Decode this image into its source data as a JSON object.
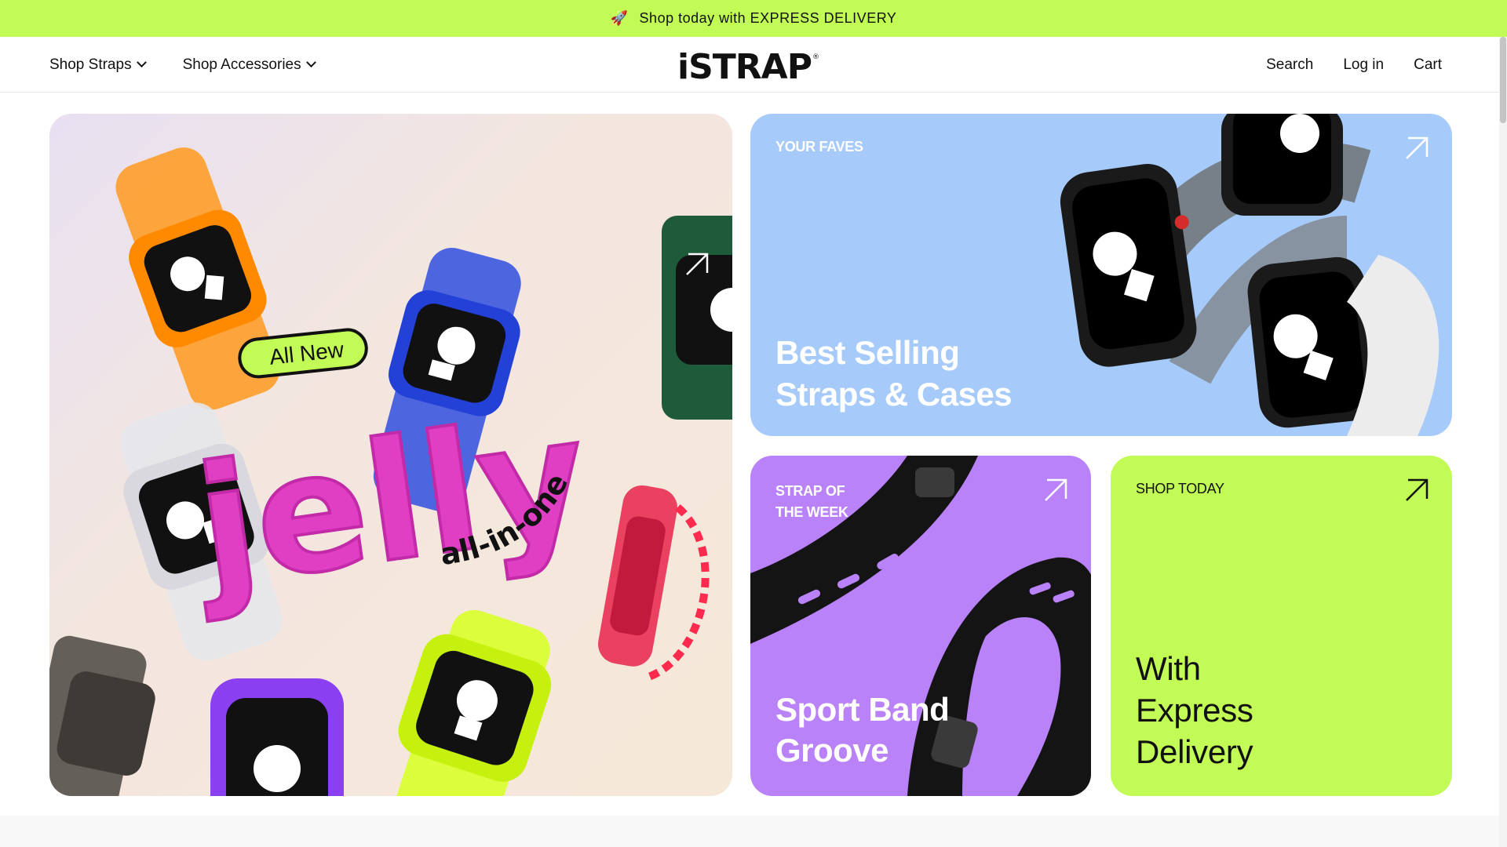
{
  "announcement": {
    "icon": "rocket-icon",
    "text": "Shop today with EXPRESS DELIVERY"
  },
  "header": {
    "logo": "iSTRAP",
    "logo_mark": "®",
    "nav_left": [
      {
        "label": "Shop Straps"
      },
      {
        "label": "Shop Accessories"
      }
    ],
    "nav_right": {
      "search": "Search",
      "login": "Log in",
      "cart": "Cart"
    }
  },
  "hero": {
    "badge": "All New",
    "title": "jelly",
    "subtitle": "all-in-one"
  },
  "cards": {
    "faves": {
      "eyebrow": "YOUR FAVES",
      "line1": "Best Selling",
      "line2": "Straps & Cases"
    },
    "strap_of_week": {
      "eyebrow_line1": "STRAP OF",
      "eyebrow_line2": "THE WEEK",
      "line1": "Sport Band",
      "line2": "Groove"
    },
    "shop_today": {
      "eyebrow": "SHOP TODAY",
      "line1": "With",
      "line2": "Express",
      "line3": "Delivery"
    }
  },
  "colors": {
    "accent_lime": "#c2fb55",
    "faves_blue": "#a6cbfb",
    "strap_purple": "#b982f9",
    "jelly_pink": "#e03fc4"
  }
}
